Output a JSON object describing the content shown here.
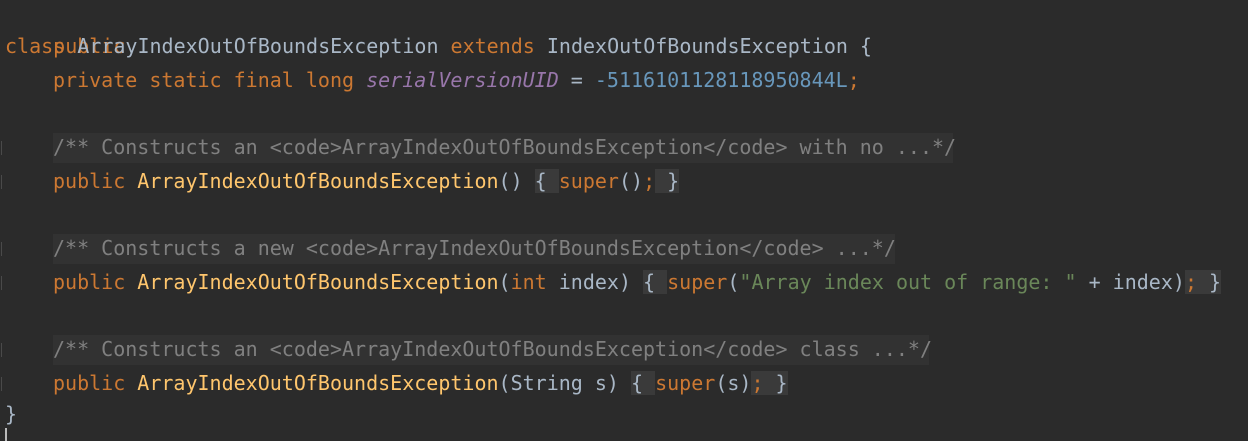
{
  "code": {
    "l1": {
      "kw": "public"
    },
    "l2": {
      "kw_class": "class",
      "name": " ArrayIndexOutOfBoundsException ",
      "kw_extends": "extends",
      "parent": " IndexOutOfBoundsException {"
    },
    "l3": {
      "mods": "private static final long ",
      "field": "serialVersionUID",
      "eq": " = ",
      "value": "-5116101128118950844L",
      "semi": ";"
    },
    "l5": {
      "comment": "/** Constructs an <code>ArrayIndexOutOfBoundsException</code> with no ...*/"
    },
    "l6": {
      "kw": "public ",
      "ctor": "ArrayIndexOutOfBoundsException",
      "params": "()",
      "sp": " ",
      "open": "{ ",
      "super": "super",
      "args": "()",
      "semi": ";",
      "close": " }"
    },
    "l8": {
      "comment": "/** Constructs a new <code>ArrayIndexOutOfBoundsException</code> ...*/"
    },
    "l9": {
      "kw": "public ",
      "ctor": "ArrayIndexOutOfBoundsException",
      "p_open": "(",
      "p_type": "int",
      "p_name": " index)",
      "sp": " ",
      "open": "{ ",
      "super": "super",
      "a_open": "(",
      "a_str": "\"Array index out of range: \"",
      "a_rest": " + index)",
      "semi": ";",
      "close": " }"
    },
    "l11": {
      "comment": "/** Constructs an <code>ArrayIndexOutOfBoundsException</code> class ...*/"
    },
    "l12": {
      "kw": "public ",
      "ctor": "ArrayIndexOutOfBoundsException",
      "params": "(String s)",
      "sp": " ",
      "open": "{ ",
      "super": "super",
      "args": "(s)",
      "semi": ";",
      "close": " }"
    },
    "l13": {
      "brace": "}"
    }
  },
  "theme": {
    "background": "#2b2b2b",
    "keyword": "#cc7832",
    "identifier": "#a9b7c6",
    "function": "#ffc66d",
    "field": "#9876aa",
    "number": "#6897bb",
    "string": "#6a8759",
    "comment": "#808080",
    "fold_highlight": "#3a3a3a"
  }
}
